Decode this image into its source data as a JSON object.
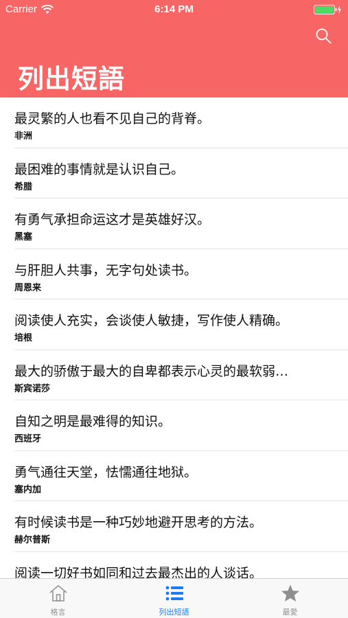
{
  "status_bar": {
    "carrier": "Carrier",
    "time": "6:14 PM"
  },
  "header": {
    "title": "列出短語",
    "search_icon": "search-icon",
    "color": "#f76565"
  },
  "quotes": [
    {
      "text": "最灵繁的人也看不见自己的背脊。",
      "author": "非洲"
    },
    {
      "text": "最困难的事情就是认识自己。",
      "author": "希腊"
    },
    {
      "text": "有勇气承担命运这才是英雄好汉。",
      "author": "黑塞"
    },
    {
      "text": "与肝胆人共事，无字句处读书。",
      "author": "周恩来"
    },
    {
      "text": "阅读使人充实，会谈使人敏捷，写作使人精确。",
      "author": "培根"
    },
    {
      "text": "最大的骄傲于最大的自卑都表示心灵的最软弱…",
      "author": "斯宾诺莎"
    },
    {
      "text": "自知之明是最难得的知识。",
      "author": "西班牙"
    },
    {
      "text": "勇气通往天堂，怯懦通往地狱。",
      "author": "塞内加"
    },
    {
      "text": "有时候读书是一种巧妙地避开思考的方法。",
      "author": "赫尔普斯"
    },
    {
      "text": "阅读一切好书如同和过去最杰出的人谈话。",
      "author": ""
    }
  ],
  "tabbar": {
    "tabs": [
      {
        "label": "格言",
        "icon": "home-icon",
        "active": false
      },
      {
        "label": "列出短語",
        "icon": "list-icon",
        "active": true
      },
      {
        "label": "最愛",
        "icon": "star-icon",
        "active": false
      }
    ],
    "active_color": "#1e7cf2",
    "inactive_color": "#929292"
  }
}
